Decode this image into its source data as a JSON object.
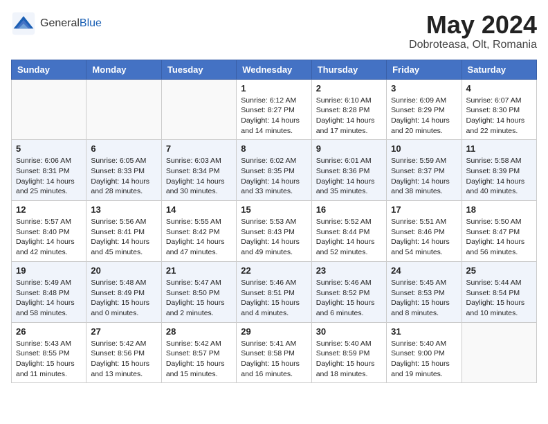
{
  "header": {
    "logo_general": "General",
    "logo_blue": "Blue",
    "month_title": "May 2024",
    "subtitle": "Dobroteasa, Olt, Romania"
  },
  "weekdays": [
    "Sunday",
    "Monday",
    "Tuesday",
    "Wednesday",
    "Thursday",
    "Friday",
    "Saturday"
  ],
  "weeks": [
    [
      {
        "day": "",
        "sunrise": "",
        "sunset": "",
        "daylight": ""
      },
      {
        "day": "",
        "sunrise": "",
        "sunset": "",
        "daylight": ""
      },
      {
        "day": "",
        "sunrise": "",
        "sunset": "",
        "daylight": ""
      },
      {
        "day": "1",
        "sunrise": "Sunrise: 6:12 AM",
        "sunset": "Sunset: 8:27 PM",
        "daylight": "Daylight: 14 hours and 14 minutes."
      },
      {
        "day": "2",
        "sunrise": "Sunrise: 6:10 AM",
        "sunset": "Sunset: 8:28 PM",
        "daylight": "Daylight: 14 hours and 17 minutes."
      },
      {
        "day": "3",
        "sunrise": "Sunrise: 6:09 AM",
        "sunset": "Sunset: 8:29 PM",
        "daylight": "Daylight: 14 hours and 20 minutes."
      },
      {
        "day": "4",
        "sunrise": "Sunrise: 6:07 AM",
        "sunset": "Sunset: 8:30 PM",
        "daylight": "Daylight: 14 hours and 22 minutes."
      }
    ],
    [
      {
        "day": "5",
        "sunrise": "Sunrise: 6:06 AM",
        "sunset": "Sunset: 8:31 PM",
        "daylight": "Daylight: 14 hours and 25 minutes."
      },
      {
        "day": "6",
        "sunrise": "Sunrise: 6:05 AM",
        "sunset": "Sunset: 8:33 PM",
        "daylight": "Daylight: 14 hours and 28 minutes."
      },
      {
        "day": "7",
        "sunrise": "Sunrise: 6:03 AM",
        "sunset": "Sunset: 8:34 PM",
        "daylight": "Daylight: 14 hours and 30 minutes."
      },
      {
        "day": "8",
        "sunrise": "Sunrise: 6:02 AM",
        "sunset": "Sunset: 8:35 PM",
        "daylight": "Daylight: 14 hours and 33 minutes."
      },
      {
        "day": "9",
        "sunrise": "Sunrise: 6:01 AM",
        "sunset": "Sunset: 8:36 PM",
        "daylight": "Daylight: 14 hours and 35 minutes."
      },
      {
        "day": "10",
        "sunrise": "Sunrise: 5:59 AM",
        "sunset": "Sunset: 8:37 PM",
        "daylight": "Daylight: 14 hours and 38 minutes."
      },
      {
        "day": "11",
        "sunrise": "Sunrise: 5:58 AM",
        "sunset": "Sunset: 8:39 PM",
        "daylight": "Daylight: 14 hours and 40 minutes."
      }
    ],
    [
      {
        "day": "12",
        "sunrise": "Sunrise: 5:57 AM",
        "sunset": "Sunset: 8:40 PM",
        "daylight": "Daylight: 14 hours and 42 minutes."
      },
      {
        "day": "13",
        "sunrise": "Sunrise: 5:56 AM",
        "sunset": "Sunset: 8:41 PM",
        "daylight": "Daylight: 14 hours and 45 minutes."
      },
      {
        "day": "14",
        "sunrise": "Sunrise: 5:55 AM",
        "sunset": "Sunset: 8:42 PM",
        "daylight": "Daylight: 14 hours and 47 minutes."
      },
      {
        "day": "15",
        "sunrise": "Sunrise: 5:53 AM",
        "sunset": "Sunset: 8:43 PM",
        "daylight": "Daylight: 14 hours and 49 minutes."
      },
      {
        "day": "16",
        "sunrise": "Sunrise: 5:52 AM",
        "sunset": "Sunset: 8:44 PM",
        "daylight": "Daylight: 14 hours and 52 minutes."
      },
      {
        "day": "17",
        "sunrise": "Sunrise: 5:51 AM",
        "sunset": "Sunset: 8:46 PM",
        "daylight": "Daylight: 14 hours and 54 minutes."
      },
      {
        "day": "18",
        "sunrise": "Sunrise: 5:50 AM",
        "sunset": "Sunset: 8:47 PM",
        "daylight": "Daylight: 14 hours and 56 minutes."
      }
    ],
    [
      {
        "day": "19",
        "sunrise": "Sunrise: 5:49 AM",
        "sunset": "Sunset: 8:48 PM",
        "daylight": "Daylight: 14 hours and 58 minutes."
      },
      {
        "day": "20",
        "sunrise": "Sunrise: 5:48 AM",
        "sunset": "Sunset: 8:49 PM",
        "daylight": "Daylight: 15 hours and 0 minutes."
      },
      {
        "day": "21",
        "sunrise": "Sunrise: 5:47 AM",
        "sunset": "Sunset: 8:50 PM",
        "daylight": "Daylight: 15 hours and 2 minutes."
      },
      {
        "day": "22",
        "sunrise": "Sunrise: 5:46 AM",
        "sunset": "Sunset: 8:51 PM",
        "daylight": "Daylight: 15 hours and 4 minutes."
      },
      {
        "day": "23",
        "sunrise": "Sunrise: 5:46 AM",
        "sunset": "Sunset: 8:52 PM",
        "daylight": "Daylight: 15 hours and 6 minutes."
      },
      {
        "day": "24",
        "sunrise": "Sunrise: 5:45 AM",
        "sunset": "Sunset: 8:53 PM",
        "daylight": "Daylight: 15 hours and 8 minutes."
      },
      {
        "day": "25",
        "sunrise": "Sunrise: 5:44 AM",
        "sunset": "Sunset: 8:54 PM",
        "daylight": "Daylight: 15 hours and 10 minutes."
      }
    ],
    [
      {
        "day": "26",
        "sunrise": "Sunrise: 5:43 AM",
        "sunset": "Sunset: 8:55 PM",
        "daylight": "Daylight: 15 hours and 11 minutes."
      },
      {
        "day": "27",
        "sunrise": "Sunrise: 5:42 AM",
        "sunset": "Sunset: 8:56 PM",
        "daylight": "Daylight: 15 hours and 13 minutes."
      },
      {
        "day": "28",
        "sunrise": "Sunrise: 5:42 AM",
        "sunset": "Sunset: 8:57 PM",
        "daylight": "Daylight: 15 hours and 15 minutes."
      },
      {
        "day": "29",
        "sunrise": "Sunrise: 5:41 AM",
        "sunset": "Sunset: 8:58 PM",
        "daylight": "Daylight: 15 hours and 16 minutes."
      },
      {
        "day": "30",
        "sunrise": "Sunrise: 5:40 AM",
        "sunset": "Sunset: 8:59 PM",
        "daylight": "Daylight: 15 hours and 18 minutes."
      },
      {
        "day": "31",
        "sunrise": "Sunrise: 5:40 AM",
        "sunset": "Sunset: 9:00 PM",
        "daylight": "Daylight: 15 hours and 19 minutes."
      },
      {
        "day": "",
        "sunrise": "",
        "sunset": "",
        "daylight": ""
      }
    ]
  ]
}
